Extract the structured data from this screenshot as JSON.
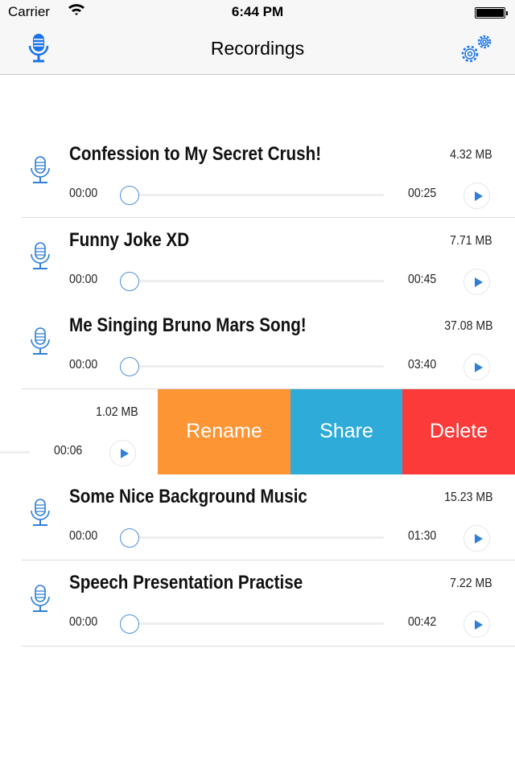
{
  "status": {
    "carrier": "Carrier",
    "time": "6:44 PM"
  },
  "nav": {
    "title": "Recordings",
    "left_icon": "microphone-icon",
    "right_icon": "gears-icon",
    "accent": "#1a73e8"
  },
  "recordings": [
    {
      "title": "Confession to My Secret Crush!",
      "size": "4.32 MB",
      "current": "00:00",
      "duration": "00:25"
    },
    {
      "title": "Funny Joke XD",
      "size": "7.71 MB",
      "current": "00:00",
      "duration": "00:45"
    },
    {
      "title": "Me Singing Bruno Mars Song!",
      "size": "37.08 MB",
      "current": "00:00",
      "duration": "03:40"
    },
    {
      "size": "1.02 MB",
      "duration": "00:06",
      "swiped": true
    },
    {
      "title": "Some Nice Background Music",
      "size": "15.23 MB",
      "current": "00:00",
      "duration": "01:30"
    },
    {
      "title": "Speech Presentation Practise",
      "size": "7.22 MB",
      "current": "00:00",
      "duration": "00:42"
    }
  ],
  "swipe_actions": [
    {
      "label": "Rename",
      "color": "#fd9535"
    },
    {
      "label": "Share",
      "color": "#2eabd9"
    },
    {
      "label": "Delete",
      "color": "#fc3a3a"
    }
  ]
}
